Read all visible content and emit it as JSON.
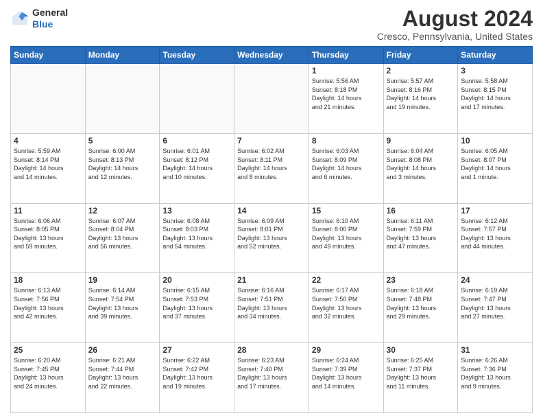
{
  "logo": {
    "general": "General",
    "blue": "Blue"
  },
  "header": {
    "title": "August 2024",
    "subtitle": "Cresco, Pennsylvania, United States"
  },
  "weekdays": [
    "Sunday",
    "Monday",
    "Tuesday",
    "Wednesday",
    "Thursday",
    "Friday",
    "Saturday"
  ],
  "weeks": [
    [
      {
        "day": "",
        "info": ""
      },
      {
        "day": "",
        "info": ""
      },
      {
        "day": "",
        "info": ""
      },
      {
        "day": "",
        "info": ""
      },
      {
        "day": "1",
        "info": "Sunrise: 5:56 AM\nSunset: 8:18 PM\nDaylight: 14 hours\nand 21 minutes."
      },
      {
        "day": "2",
        "info": "Sunrise: 5:57 AM\nSunset: 8:16 PM\nDaylight: 14 hours\nand 19 minutes."
      },
      {
        "day": "3",
        "info": "Sunrise: 5:58 AM\nSunset: 8:15 PM\nDaylight: 14 hours\nand 17 minutes."
      }
    ],
    [
      {
        "day": "4",
        "info": "Sunrise: 5:59 AM\nSunset: 8:14 PM\nDaylight: 14 hours\nand 14 minutes."
      },
      {
        "day": "5",
        "info": "Sunrise: 6:00 AM\nSunset: 8:13 PM\nDaylight: 14 hours\nand 12 minutes."
      },
      {
        "day": "6",
        "info": "Sunrise: 6:01 AM\nSunset: 8:12 PM\nDaylight: 14 hours\nand 10 minutes."
      },
      {
        "day": "7",
        "info": "Sunrise: 6:02 AM\nSunset: 8:11 PM\nDaylight: 14 hours\nand 8 minutes."
      },
      {
        "day": "8",
        "info": "Sunrise: 6:03 AM\nSunset: 8:09 PM\nDaylight: 14 hours\nand 6 minutes."
      },
      {
        "day": "9",
        "info": "Sunrise: 6:04 AM\nSunset: 8:08 PM\nDaylight: 14 hours\nand 3 minutes."
      },
      {
        "day": "10",
        "info": "Sunrise: 6:05 AM\nSunset: 8:07 PM\nDaylight: 14 hours\nand 1 minute."
      }
    ],
    [
      {
        "day": "11",
        "info": "Sunrise: 6:06 AM\nSunset: 8:05 PM\nDaylight: 13 hours\nand 59 minutes."
      },
      {
        "day": "12",
        "info": "Sunrise: 6:07 AM\nSunset: 8:04 PM\nDaylight: 13 hours\nand 56 minutes."
      },
      {
        "day": "13",
        "info": "Sunrise: 6:08 AM\nSunset: 8:03 PM\nDaylight: 13 hours\nand 54 minutes."
      },
      {
        "day": "14",
        "info": "Sunrise: 6:09 AM\nSunset: 8:01 PM\nDaylight: 13 hours\nand 52 minutes."
      },
      {
        "day": "15",
        "info": "Sunrise: 6:10 AM\nSunset: 8:00 PM\nDaylight: 13 hours\nand 49 minutes."
      },
      {
        "day": "16",
        "info": "Sunrise: 6:11 AM\nSunset: 7:59 PM\nDaylight: 13 hours\nand 47 minutes."
      },
      {
        "day": "17",
        "info": "Sunrise: 6:12 AM\nSunset: 7:57 PM\nDaylight: 13 hours\nand 44 minutes."
      }
    ],
    [
      {
        "day": "18",
        "info": "Sunrise: 6:13 AM\nSunset: 7:56 PM\nDaylight: 13 hours\nand 42 minutes."
      },
      {
        "day": "19",
        "info": "Sunrise: 6:14 AM\nSunset: 7:54 PM\nDaylight: 13 hours\nand 39 minutes."
      },
      {
        "day": "20",
        "info": "Sunrise: 6:15 AM\nSunset: 7:53 PM\nDaylight: 13 hours\nand 37 minutes."
      },
      {
        "day": "21",
        "info": "Sunrise: 6:16 AM\nSunset: 7:51 PM\nDaylight: 13 hours\nand 34 minutes."
      },
      {
        "day": "22",
        "info": "Sunrise: 6:17 AM\nSunset: 7:50 PM\nDaylight: 13 hours\nand 32 minutes."
      },
      {
        "day": "23",
        "info": "Sunrise: 6:18 AM\nSunset: 7:48 PM\nDaylight: 13 hours\nand 29 minutes."
      },
      {
        "day": "24",
        "info": "Sunrise: 6:19 AM\nSunset: 7:47 PM\nDaylight: 13 hours\nand 27 minutes."
      }
    ],
    [
      {
        "day": "25",
        "info": "Sunrise: 6:20 AM\nSunset: 7:45 PM\nDaylight: 13 hours\nand 24 minutes."
      },
      {
        "day": "26",
        "info": "Sunrise: 6:21 AM\nSunset: 7:44 PM\nDaylight: 13 hours\nand 22 minutes."
      },
      {
        "day": "27",
        "info": "Sunrise: 6:22 AM\nSunset: 7:42 PM\nDaylight: 13 hours\nand 19 minutes."
      },
      {
        "day": "28",
        "info": "Sunrise: 6:23 AM\nSunset: 7:40 PM\nDaylight: 13 hours\nand 17 minutes."
      },
      {
        "day": "29",
        "info": "Sunrise: 6:24 AM\nSunset: 7:39 PM\nDaylight: 13 hours\nand 14 minutes."
      },
      {
        "day": "30",
        "info": "Sunrise: 6:25 AM\nSunset: 7:37 PM\nDaylight: 13 hours\nand 11 minutes."
      },
      {
        "day": "31",
        "info": "Sunrise: 6:26 AM\nSunset: 7:36 PM\nDaylight: 13 hours\nand 9 minutes."
      }
    ]
  ]
}
